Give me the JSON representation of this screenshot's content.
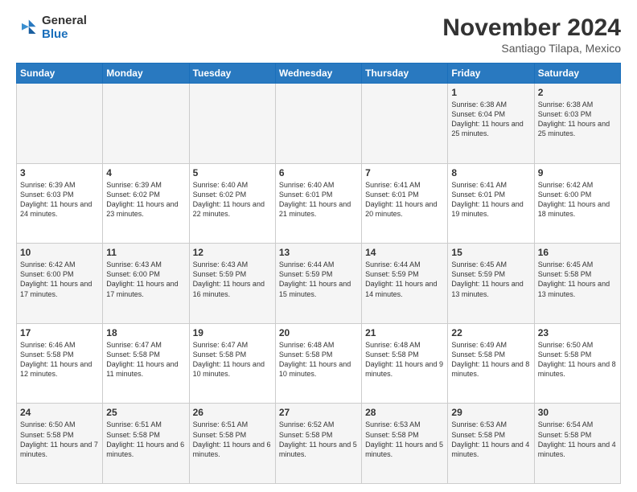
{
  "logo": {
    "general": "General",
    "blue": "Blue"
  },
  "title": "November 2024",
  "subtitle": "Santiago Tilapa, Mexico",
  "days_header": [
    "Sunday",
    "Monday",
    "Tuesday",
    "Wednesday",
    "Thursday",
    "Friday",
    "Saturday"
  ],
  "weeks": [
    [
      {
        "day": "",
        "info": ""
      },
      {
        "day": "",
        "info": ""
      },
      {
        "day": "",
        "info": ""
      },
      {
        "day": "",
        "info": ""
      },
      {
        "day": "",
        "info": ""
      },
      {
        "day": "1",
        "info": "Sunrise: 6:38 AM\nSunset: 6:04 PM\nDaylight: 11 hours and 25 minutes."
      },
      {
        "day": "2",
        "info": "Sunrise: 6:38 AM\nSunset: 6:03 PM\nDaylight: 11 hours and 25 minutes."
      }
    ],
    [
      {
        "day": "3",
        "info": "Sunrise: 6:39 AM\nSunset: 6:03 PM\nDaylight: 11 hours and 24 minutes."
      },
      {
        "day": "4",
        "info": "Sunrise: 6:39 AM\nSunset: 6:02 PM\nDaylight: 11 hours and 23 minutes."
      },
      {
        "day": "5",
        "info": "Sunrise: 6:40 AM\nSunset: 6:02 PM\nDaylight: 11 hours and 22 minutes."
      },
      {
        "day": "6",
        "info": "Sunrise: 6:40 AM\nSunset: 6:01 PM\nDaylight: 11 hours and 21 minutes."
      },
      {
        "day": "7",
        "info": "Sunrise: 6:41 AM\nSunset: 6:01 PM\nDaylight: 11 hours and 20 minutes."
      },
      {
        "day": "8",
        "info": "Sunrise: 6:41 AM\nSunset: 6:01 PM\nDaylight: 11 hours and 19 minutes."
      },
      {
        "day": "9",
        "info": "Sunrise: 6:42 AM\nSunset: 6:00 PM\nDaylight: 11 hours and 18 minutes."
      }
    ],
    [
      {
        "day": "10",
        "info": "Sunrise: 6:42 AM\nSunset: 6:00 PM\nDaylight: 11 hours and 17 minutes."
      },
      {
        "day": "11",
        "info": "Sunrise: 6:43 AM\nSunset: 6:00 PM\nDaylight: 11 hours and 17 minutes."
      },
      {
        "day": "12",
        "info": "Sunrise: 6:43 AM\nSunset: 5:59 PM\nDaylight: 11 hours and 16 minutes."
      },
      {
        "day": "13",
        "info": "Sunrise: 6:44 AM\nSunset: 5:59 PM\nDaylight: 11 hours and 15 minutes."
      },
      {
        "day": "14",
        "info": "Sunrise: 6:44 AM\nSunset: 5:59 PM\nDaylight: 11 hours and 14 minutes."
      },
      {
        "day": "15",
        "info": "Sunrise: 6:45 AM\nSunset: 5:59 PM\nDaylight: 11 hours and 13 minutes."
      },
      {
        "day": "16",
        "info": "Sunrise: 6:45 AM\nSunset: 5:58 PM\nDaylight: 11 hours and 13 minutes."
      }
    ],
    [
      {
        "day": "17",
        "info": "Sunrise: 6:46 AM\nSunset: 5:58 PM\nDaylight: 11 hours and 12 minutes."
      },
      {
        "day": "18",
        "info": "Sunrise: 6:47 AM\nSunset: 5:58 PM\nDaylight: 11 hours and 11 minutes."
      },
      {
        "day": "19",
        "info": "Sunrise: 6:47 AM\nSunset: 5:58 PM\nDaylight: 11 hours and 10 minutes."
      },
      {
        "day": "20",
        "info": "Sunrise: 6:48 AM\nSunset: 5:58 PM\nDaylight: 11 hours and 10 minutes."
      },
      {
        "day": "21",
        "info": "Sunrise: 6:48 AM\nSunset: 5:58 PM\nDaylight: 11 hours and 9 minutes."
      },
      {
        "day": "22",
        "info": "Sunrise: 6:49 AM\nSunset: 5:58 PM\nDaylight: 11 hours and 8 minutes."
      },
      {
        "day": "23",
        "info": "Sunrise: 6:50 AM\nSunset: 5:58 PM\nDaylight: 11 hours and 8 minutes."
      }
    ],
    [
      {
        "day": "24",
        "info": "Sunrise: 6:50 AM\nSunset: 5:58 PM\nDaylight: 11 hours and 7 minutes."
      },
      {
        "day": "25",
        "info": "Sunrise: 6:51 AM\nSunset: 5:58 PM\nDaylight: 11 hours and 6 minutes."
      },
      {
        "day": "26",
        "info": "Sunrise: 6:51 AM\nSunset: 5:58 PM\nDaylight: 11 hours and 6 minutes."
      },
      {
        "day": "27",
        "info": "Sunrise: 6:52 AM\nSunset: 5:58 PM\nDaylight: 11 hours and 5 minutes."
      },
      {
        "day": "28",
        "info": "Sunrise: 6:53 AM\nSunset: 5:58 PM\nDaylight: 11 hours and 5 minutes."
      },
      {
        "day": "29",
        "info": "Sunrise: 6:53 AM\nSunset: 5:58 PM\nDaylight: 11 hours and 4 minutes."
      },
      {
        "day": "30",
        "info": "Sunrise: 6:54 AM\nSunset: 5:58 PM\nDaylight: 11 hours and 4 minutes."
      }
    ]
  ]
}
